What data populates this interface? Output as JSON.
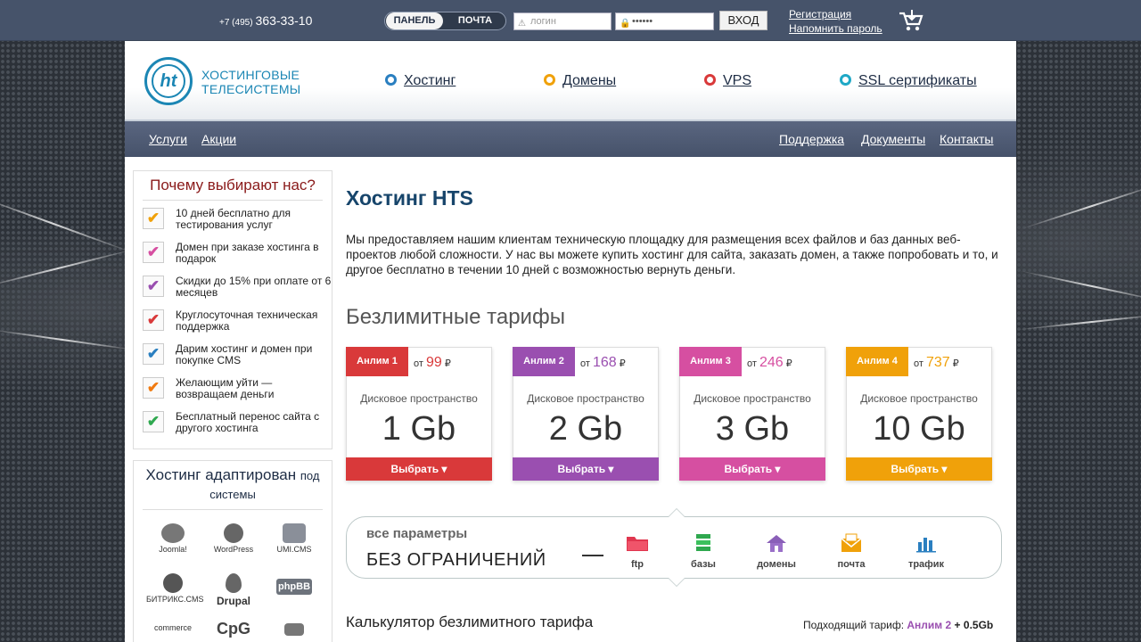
{
  "topbar": {
    "phone_code": "+7 (495)",
    "phone_number": "363-33-10",
    "toggle": [
      "ПАНЕЛЬ",
      "ПОЧТА"
    ],
    "login_placeholder": "логин",
    "password_value": "••••••",
    "enter_label": "ВХОД",
    "register_link": "Регистрация",
    "remind_link": "Напомнить пароль"
  },
  "header": {
    "logo_mark": "ht",
    "logo_line1": "ХОСТИНГОВЫЕ",
    "logo_line2": "ТЕЛЕСИСТЕМЫ",
    "nav": [
      {
        "label": "Хостинг",
        "color": "#2a7fc0"
      },
      {
        "label": "Домены",
        "color": "#f0a10a"
      },
      {
        "label": "VPS",
        "color": "#d9393a"
      },
      {
        "label": "SSL сертификаты",
        "color": "#1fa8c6"
      }
    ]
  },
  "subnav": {
    "left": [
      "Услуги",
      "Акции"
    ],
    "right": [
      "Поддержка",
      "Документы",
      "Контакты"
    ]
  },
  "sidebar": {
    "why_title": "Почему выбирают нас?",
    "items": [
      {
        "text": "10 дней бесплатно для тестирования услуг",
        "color": "#f0a10a"
      },
      {
        "text": "Домен при заказе хостинга в подарок",
        "color": "#d64fa1"
      },
      {
        "text": "Скидки до 15% при оплате от 6 месяцев",
        "color": "#9a4fb0"
      },
      {
        "text": "Круглосуточная техническая поддержка",
        "color": "#d9393a"
      },
      {
        "text": "Дарим хостинг и домен при покупке CMS",
        "color": "#2a7fc0"
      },
      {
        "text": "Желающим уйти — возвращаем деньги",
        "color": "#f07a10"
      },
      {
        "text": "Бесплатный перенос сайта с другого хостинга",
        "color": "#2fa84f"
      }
    ],
    "check_glyph": "✔",
    "cms_title": "Хостинг адаптирован",
    "cms_title_small": "под системы",
    "cms": [
      "Joomla!",
      "WordPress",
      "UMI.CMS",
      "БИТРИКС.CMS",
      "Drupal",
      "phpBB",
      "commerce",
      "CpG",
      ""
    ]
  },
  "main": {
    "title": "Хостинг HTS",
    "intro": "Мы предоставляем нашим клиентам техническую площадку для размещения всех файлов и баз данных веб-проектов любой сложности. У нас вы можете купить хостинг для сайта, заказать домен, а также попробовать и то, и другое бесплатно в течении 10 дней с возможностью вернуть деньги.",
    "section_title": "Безлимитные тарифы",
    "plans": [
      {
        "name": "Анлим 1",
        "from": "от",
        "price": "99",
        "currency": "₽",
        "label": "Дисковое пространство",
        "size": "1 Gb",
        "select": "Выбрать ▾",
        "color": "#d9393a"
      },
      {
        "name": "Анлим 2",
        "from": "от",
        "price": "168",
        "currency": "₽",
        "label": "Дисковое пространство",
        "size": "2 Gb",
        "select": "Выбрать ▾",
        "color": "#9a4fb0"
      },
      {
        "name": "Анлим 3",
        "from": "от",
        "price": "246",
        "currency": "₽",
        "label": "Дисковое пространство",
        "size": "3 Gb",
        "select": "Выбрать ▾",
        "color": "#d64fa1"
      },
      {
        "name": "Анлим 4",
        "from": "от",
        "price": "737",
        "currency": "₽",
        "label": "Дисковое пространство",
        "size": "10 Gb",
        "select": "Выбрать ▾",
        "color": "#f0a10a"
      }
    ],
    "params_line1": "все параметры",
    "params_line2": "БЕЗ ОГРАНИЧЕНИЙ",
    "params": [
      {
        "label": "ftp",
        "icon": "folder-icon"
      },
      {
        "label": "базы",
        "icon": "database-icon"
      },
      {
        "label": "домены",
        "icon": "house-icon"
      },
      {
        "label": "почта",
        "icon": "envelope-icon"
      },
      {
        "label": "трафик",
        "icon": "bar-chart-icon"
      }
    ],
    "calc_title": "Калькулятор безлимитного тарифа",
    "calc_label": "Подходящий тариф:",
    "calc_plan": "Анлим 2",
    "calc_extra": "+ 0.5Gb"
  }
}
